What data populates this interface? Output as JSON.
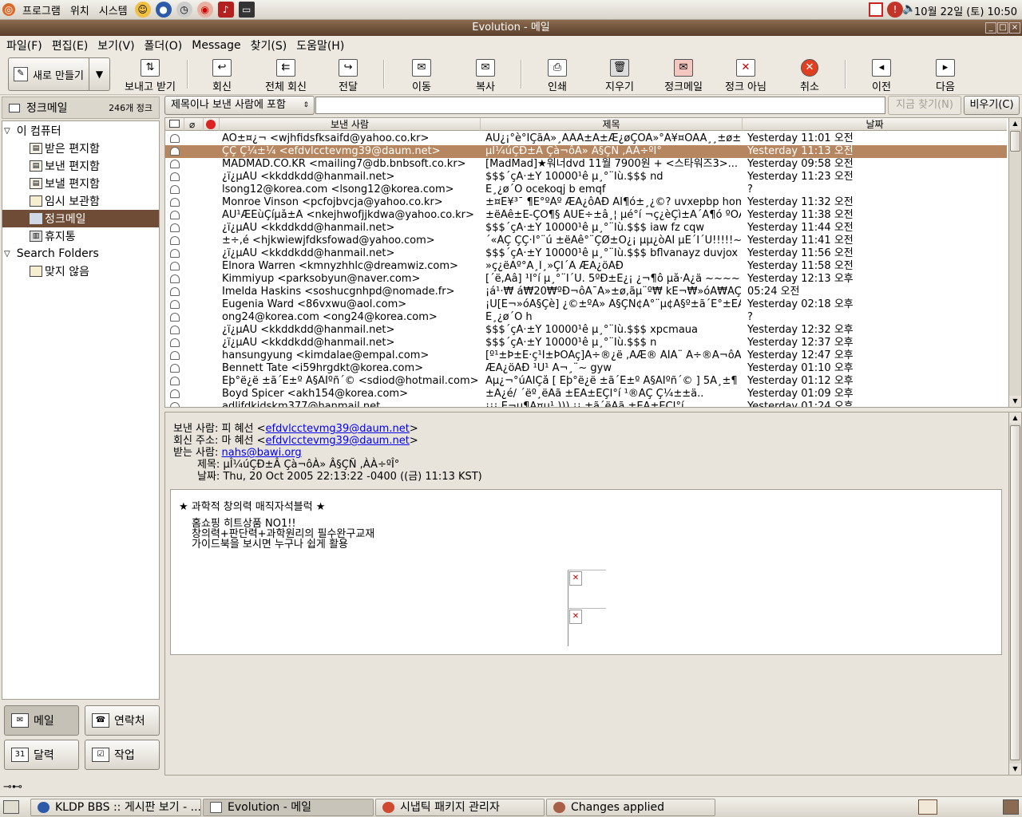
{
  "top_panel": {
    "menus": [
      "프로그램",
      "위치",
      "시스템"
    ],
    "clock": "10월 22일 (토) 10:50"
  },
  "window": {
    "title": "Evolution - 메일"
  },
  "menubar": [
    "파일(F)",
    "편집(E)",
    "보기(V)",
    "폴더(O)",
    "Message",
    "찾기(S)",
    "도움말(H)"
  ],
  "toolbar": {
    "new_label": "새로 만들기",
    "send_receive": "보내고 받기",
    "reply": "회신",
    "reply_all": "전체 회신",
    "forward": "전달",
    "move": "이동",
    "copy": "복사",
    "print": "인쇄",
    "delete": "지우기",
    "junk": "정크메일",
    "not_junk": "정크 아님",
    "cancel": "취소",
    "previous": "이전",
    "next": "다음"
  },
  "sidebar": {
    "header_title": "정크메일",
    "header_count": "246개 정크",
    "tree": {
      "root": "이 컴퓨터",
      "inbox": "받은 편지함",
      "sent": "보낸 편지함",
      "outbox": "보낼 편지함",
      "drafts": "임시 보관함",
      "junk": "정크메일",
      "trash": "휴지통",
      "search_folders": "Search Folders",
      "unmatched": "맞지 않음"
    },
    "switcher": {
      "mail": "메일",
      "contacts": "연락처",
      "calendar": "달력",
      "tasks": "작업"
    }
  },
  "search": {
    "scope": "제목이나 보낸 사람에 포함",
    "query": "",
    "find_now": "지금 찾기(N)",
    "clear": "비우기(C)"
  },
  "message_list": {
    "columns": {
      "from": "보낸 사람",
      "subject": "제목",
      "date": "날짜"
    },
    "rows": [
      {
        "from": "ÃÖ±¤¿¬ <wjhfidsfksaifd@yahoo.co.kr>",
        "subject": "ÀÚ¿¡°è°ÍÇãÀ»¸ÃÂÃ±Ã±Æ¿øÇÕÀ»°Ã¥¤ÒÃÀ¸¸±ø±Ã°±...",
        "date": "Yesterday 11:01 오전"
      },
      {
        "from": "ÇÇ Ç¼±¼ <efdvlcctevmg39@daum.net>",
        "subject": "µÎ¼úÇÐ±Â Çà¬ôÀ» Â§ÇÑ ,ÀÀ÷ºÎ°",
        "date": "Yesterday 11:13 오전",
        "selected": true
      },
      {
        "from": "MADMAD.CO.KR <mailing7@db.bnbsoft.co.kr>",
        "subject": "[MadMad]★워너dvd 11월 7900원 + <스타워즈3>...",
        "date": "Yesterday 09:58 오전"
      },
      {
        "from": "¿ï¿µÀÚ <kkddkdd@hanmail.net>",
        "subject": "$$$´çÃ·±Ý 10000¹ê µ¸°¨Ïù.$$$ nd",
        "date": "Yesterday 11:23 오전"
      },
      {
        "from": "lsong12@korea.com <lsong12@korea.com>",
        "subject": "È¸¿ø´Ô   ocekoqj b emqf",
        "date": "?"
      },
      {
        "from": "Monroe Vinson <pcfojbvcja@yahoo.co.kr>",
        "subject": "±¤Ê¥³¯ ¶Ë°ºÀº ÆÄ¿ôÀÐ ÀÎ¶ó±¸¿©? uvxepbp homo...",
        "date": "Yesterday 11:32 오전"
      },
      {
        "from": "ÀÛ¹ÆÈùÇíµå±Â <nkejhwofjjkdwa@yahoo.co.kr>",
        "subject": "±ëÂê±Ë-ÇÒ¶§ ÁÙÈ÷±â¸¦ µé°í ¬ç¿èÇì±Ã´Á¶ó ºÒÆíÇÏ±...",
        "date": "Yesterday 11:38 오전"
      },
      {
        "from": "¿ï¿µÀÚ <kkddkdd@hanmail.net>",
        "subject": "$$$´çÃ·±Ý 10000¹ê µ¸°¨Ïù.$$$  iaw fz cqw",
        "date": "Yesterday 11:44 오전"
      },
      {
        "from": "±÷,é <hjkwiewjfdksfowad@yahoo.com>",
        "subject": "´«ÂÇ ÇÇ·Î°¨ú ±ëÂê°¨ÇØ±Ò¿¡ µµ¿òÀÌ µÉ´Ï´Ù!!!!!~...",
        "date": "Yesterday 11:41 오전"
      },
      {
        "from": "¿ï¿µÀÚ <kkddkdd@hanmail.net>",
        "subject": "$$$´çÃ·±Ý 10000¹ê µ¸°¨Ïù.$$$ bflvanayz duvjox op",
        "date": "Yesterday 11:56 오전"
      },
      {
        "from": "Elnora Warren <kmnyzhhlc@dreamwiz.com>",
        "subject": "»ç¿ëÀº°Ã¸Î¸»ÇÏ´Â ÆÄ¿öÀÐ",
        "date": "Yesterday 11:58 오전"
      },
      {
        "from": "Kimmiyup <parksobyun@naver.com>",
        "subject": "[´ë,Ãâ] ¹Î°í µ¸°¨Ï´Ù. 5ºÐ±È¿¡ ¿¬¶ô µå·Á¿ä ~~~~...",
        "date": "Yesterday 12:13 오후"
      },
      {
        "from": "Imelda Haskins <soshucgnhpd@nomade.fr>",
        "subject": "¡á¹·₩ á₩20₩ºÐ¬ôÀ¯Ã»±ø,ãµ¨º₩ kÉ¬₩»óÀ₩ÀÇ₩...",
        "date": "05:24 오전"
      },
      {
        "from": "Eugenia Ward <86vxwu@aol.com>",
        "subject": "¡Ù[È¬»óÃ§Çè] ¿©±ºÀ» Â§ÇÑ¢Á°¨µ¢Â§º±ã´É°±ÈÄ¦¡...",
        "date": "Yesterday 02:18 오후"
      },
      {
        "from": "ong24@korea.com <ong24@korea.com>",
        "subject": "È¸¿ø´Ô h",
        "date": "?"
      },
      {
        "from": "¿ï¿µÀÚ <kkddkdd@hanmail.net>",
        "subject": "$$$´çÃ·±Ý 10000¹ê µ¸°¨Ïù.$$$  xpcmaua",
        "date": "Yesterday 12:32 오후"
      },
      {
        "from": "¿ï¿µÀÚ <kkddkdd@hanmail.net>",
        "subject": "$$$´çÃ·±Ý 10000¹ê µ¸°¨Ïù.$$$  n",
        "date": "Yesterday 12:37 오후"
      },
      {
        "from": "hansungyung <kimdalae@empal.com>",
        "subject": "[º¹±Þ±Ë·ç¹Ì±ÞÓÀç]À÷®¿ë ,ÃÆ® ÀÌÀ¨ Â÷®Ã¬ôÀ º...",
        "date": "Yesterday 12:47 오후"
      },
      {
        "from": "Bennett Tate <i59hrgdkt@korea.com>",
        "subject": "ÆÄ¿öÀÐ ¹Ù¹ Ã¬¸¨~ gyw",
        "date": "Yesterday 01:10 오후"
      },
      {
        "from": "Èþ°ë¿ë ±ã´Ê±º Â§ÂÌºñ´© <sdiod@hotmail.com>",
        "subject": "Ãµ¿¬°úÀÏÇå [ Èþ°ë¿ë ±ã´Ê±º Â§ÂÌºñ´© ] 5Ä¸±¶ 9.90...",
        "date": "Yesterday 01:12 오후"
      },
      {
        "from": "Boyd Spicer <akh154@korea.com>",
        "subject": "±Â¿é/ ´ëº¸ëÂã ±ÈÃ±ÈÇÏ°í ¹®ÀÇ Ç¼±±ä..",
        "date": "Yesterday 01:09 오후"
      },
      {
        "from": "adlifdkjdskm377@hanmail.net",
        "subject": "¡¡¡ È¬µ¶Ã¤µ¹ ))) ¡¡ ±ã´ëÂã ±ÈÃ±ÈÇÏ°í",
        "date": "Yesterday 01:24 오후"
      }
    ]
  },
  "preview": {
    "labels": {
      "from": "보낸 사람:",
      "reply_to": "회신 주소:",
      "to": "받는 사람:",
      "subject": "제목:",
      "date": "날짜:"
    },
    "from_name": "피 혜선 <",
    "from_email": "efdvlcctevmg39@daum.net",
    "reply_name": "마 혜선 <",
    "reply_email": "efdvlcctevmg39@daum.net",
    "close": ">",
    "to_email": "nahs@bawi.org",
    "subject": "µÎ¼úÇÐ±Â Çà¬ôÀ» Â§ÇÑ ,ÀÀ÷ºÎ°",
    "date": "Thu, 20 Oct 2005 22:13:22 -0400  ((금) 11:13 KST)",
    "body": {
      "heading": "★ 과학적 창의력 매직자석블럭 ★",
      "line1": "홈쇼핑 히트상품 NO1!!",
      "line2": "창의력+판단력+과학원리의 필수완구교재",
      "line3": "가이드북을 보시면 누구나 쉽게 활용"
    }
  },
  "taskbar": {
    "tasks": [
      "KLDP BBS :: 게시판 보기 - ...",
      "Evolution - 메일",
      "시냅틱 패키지 관리자",
      "Changes applied"
    ]
  },
  "colors": {
    "title_bar": "#6e4c36",
    "selection": "#b5865f",
    "link": "#0000ee"
  }
}
